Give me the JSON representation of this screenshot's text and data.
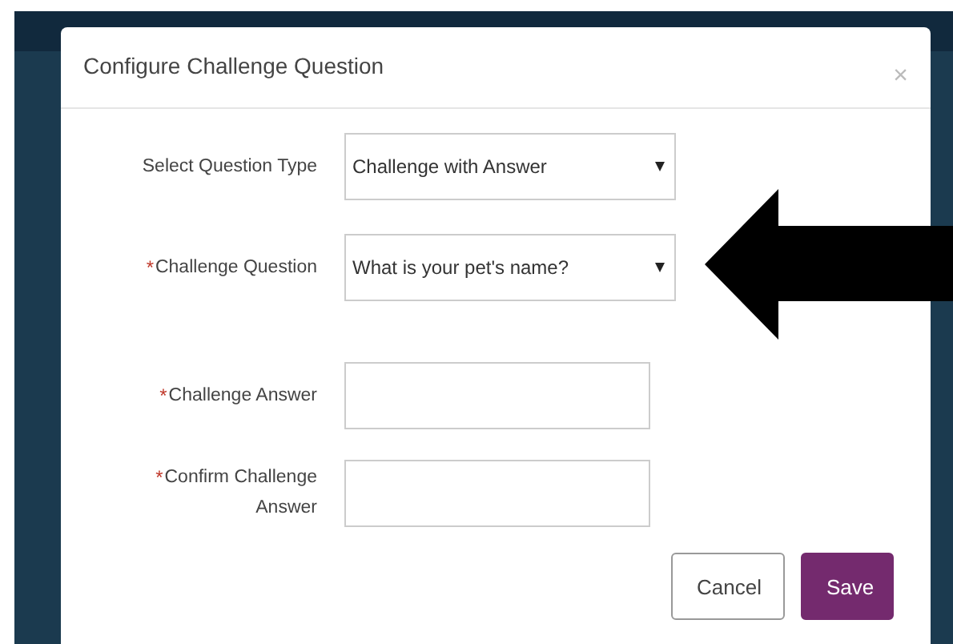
{
  "dialog": {
    "title": "Configure Challenge Question",
    "close": "×"
  },
  "fields": [
    {
      "kind": "select",
      "label": "Select Question Type",
      "required": false,
      "value": "Challenge with Answer"
    },
    {
      "kind": "select",
      "label": "Challenge Question",
      "required": true,
      "value": "What is your pet's name?"
    },
    {
      "kind": "text",
      "label": "Challenge Answer",
      "required": true
    },
    {
      "kind": "text",
      "label": "Confirm Challenge Answer",
      "required": true
    }
  ],
  "required_mark": "*",
  "buttons": [
    {
      "label": "Cancel",
      "kind": "default"
    },
    {
      "label": "Save",
      "kind": "primary"
    }
  ]
}
